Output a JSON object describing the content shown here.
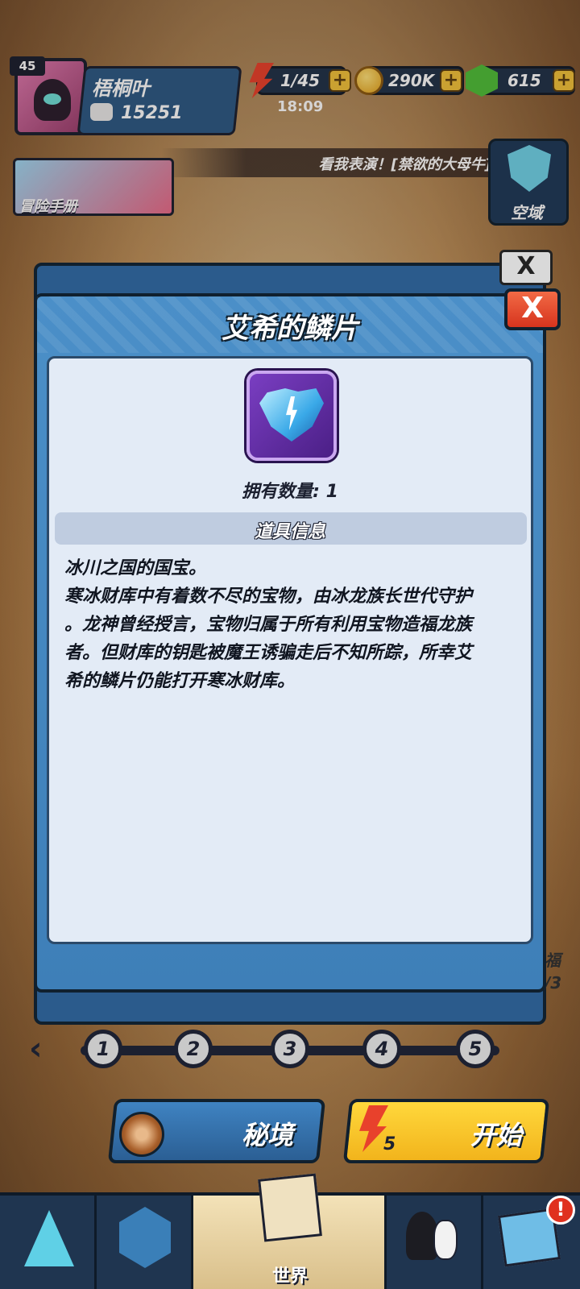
{
  "player": {
    "level": "45",
    "name": "梧桐叶",
    "power": "15251"
  },
  "resources": {
    "energy": "1/45",
    "energy_timer": "18:09",
    "coins": "290K",
    "gems": "615",
    "plus": "+"
  },
  "marquee": {
    "text": "看我表演！[禁欲的大母牛]"
  },
  "side_buttons": {
    "adventure_book": "冒险手册",
    "skyfield": "空域"
  },
  "background_panel": {
    "close": "X",
    "right_peek": "福",
    "right_peek_count": "/3"
  },
  "modal": {
    "title": "艾希的鳞片",
    "close": "X",
    "owned_label": "拥有数量: 1",
    "info_header": "道具信息",
    "description_lines": [
      "冰川之国的国宝。",
      "寒冰财库中有着数不尽的宝物，由冰龙族长世代守护",
      "。龙神曾经授言，宝物归属于所有利用宝物造福龙族",
      "者。但财库的钥匙被魔王诱骗走后不知所踪，所幸艾",
      "希的鳞片仍能打开寒冰财库。"
    ]
  },
  "stages": {
    "nodes": [
      "1",
      "2",
      "3",
      "4",
      "5"
    ],
    "prev_arrow": "‹"
  },
  "actions": {
    "secret_realm": "秘境",
    "start": "开始",
    "start_cost": "5"
  },
  "bottom_nav": {
    "active_label": "世界",
    "notification": "!"
  },
  "colors": {
    "modal_blue": "#4b8fc8",
    "close_red": "#e24a2c",
    "start_yellow": "#f7c52a",
    "card_bg": "#e3ebf6"
  },
  "icons": [
    "energy-icon",
    "coin-icon",
    "gem-icon",
    "power-icon",
    "scale-item-icon",
    "target-icon",
    "map-icon",
    "close-icon"
  ]
}
